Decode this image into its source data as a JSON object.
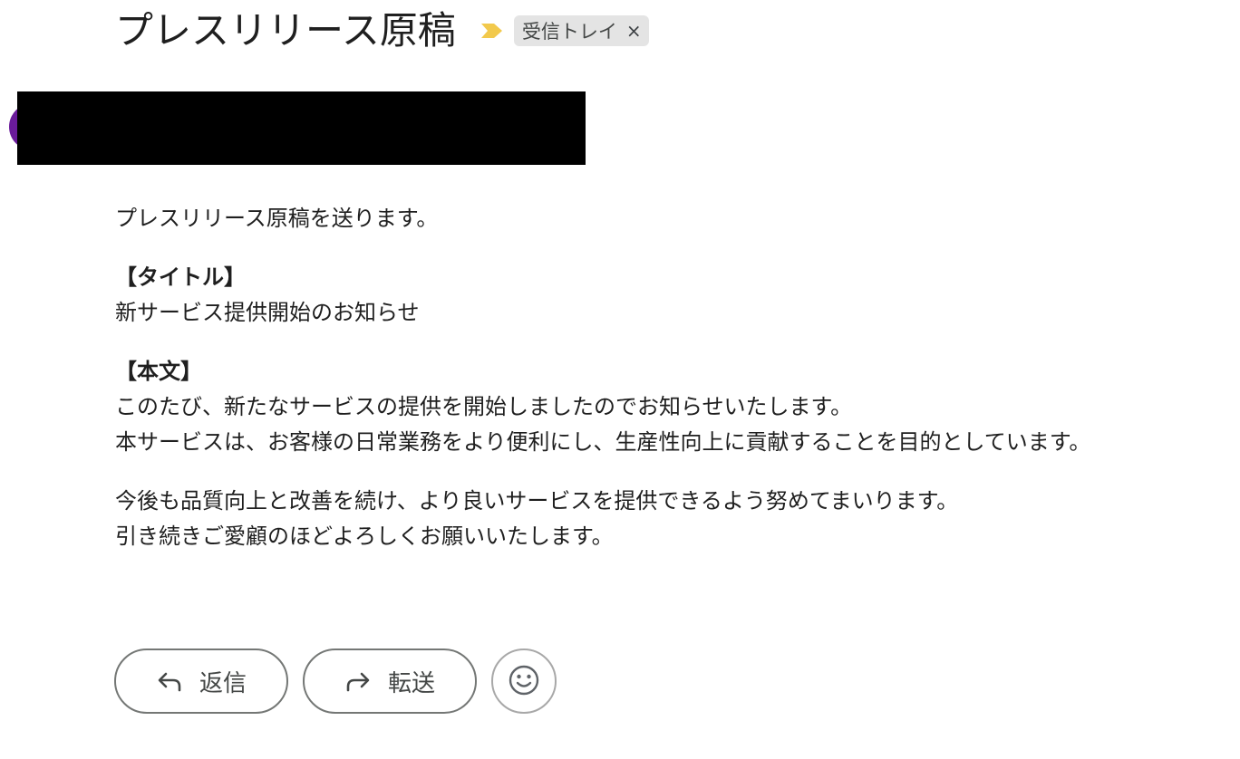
{
  "email": {
    "subject": "プレスリリース原稿",
    "label": "受信トレイ",
    "label_remove": "×"
  },
  "body": {
    "line1": "プレスリリース原稿を送ります。",
    "title_heading": "【タイトル】",
    "title_text": "新サービス提供開始のお知らせ",
    "body_heading": "【本文】",
    "para1_line1": "このたび、新たなサービスの提供を開始しましたのでお知らせいたします。",
    "para1_line2": "本サービスは、お客様の日常業務をより便利にし、生産性向上に貢献することを目的としています。",
    "para2_line1": "今後も品質向上と改善を続け、より良いサービスを提供できるよう努めてまいります。",
    "para2_line2": "引き続きご愛顧のほどよろしくお願いいたします。"
  },
  "actions": {
    "reply_label": "返信",
    "forward_label": "転送"
  },
  "icons": {
    "importance": "importance-marker-icon",
    "reply": "reply-arrow-icon",
    "forward": "forward-arrow-icon",
    "emoji": "smiley-icon"
  },
  "colors": {
    "importance": "#f2c94c",
    "avatar": "#6a1b9a",
    "chip_bg": "#e4e4e4"
  }
}
